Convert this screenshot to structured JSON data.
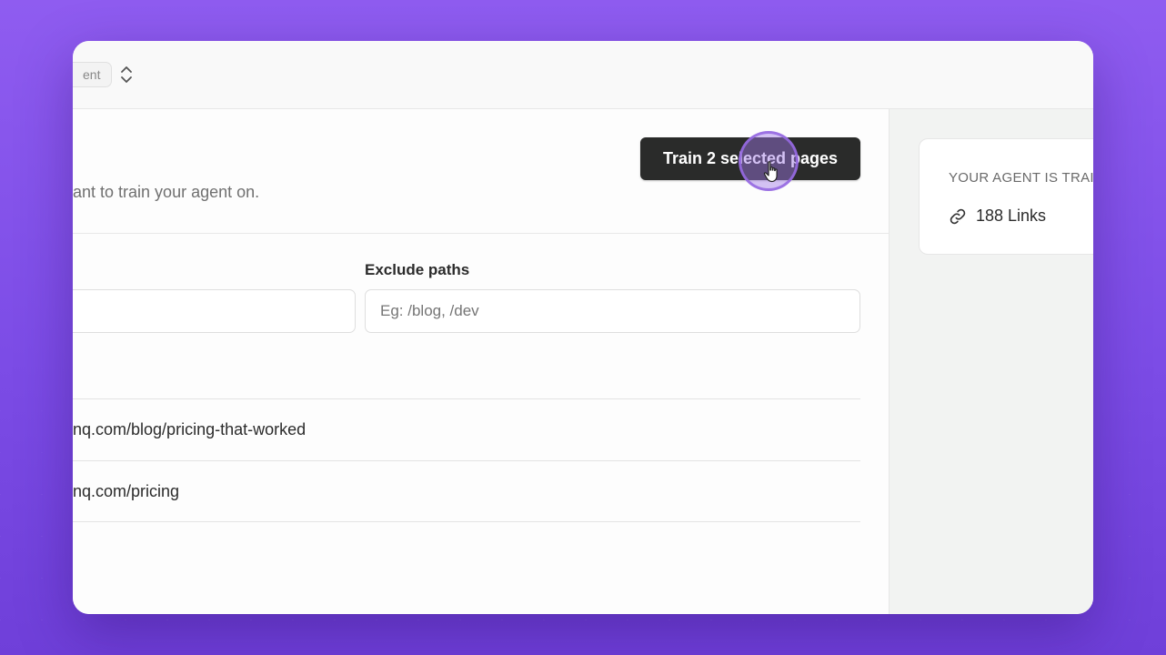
{
  "topbar": {
    "agent_chip_label": "ent"
  },
  "main": {
    "subtitle": "ant to train your agent on.",
    "train_button_label": "Train 2 selected pages",
    "exclude_label": "Exclude paths",
    "exclude_placeholder": "Eg: /blog, /dev",
    "links": [
      {
        "url": "nq.com/blog/pricing-that-worked"
      },
      {
        "url": "nq.com/pricing"
      }
    ]
  },
  "side": {
    "heading": "YOUR AGENT IS TRAI",
    "links_count_label": "188 Links"
  },
  "icons": {
    "switcher": "chevron-up-down-icon",
    "link": "link-icon",
    "cursor": "hand-pointer-icon"
  },
  "colors": {
    "background": "#8f5cf0",
    "primary_button": "#2a2b2a",
    "click_highlight": "#9a6ae0"
  }
}
